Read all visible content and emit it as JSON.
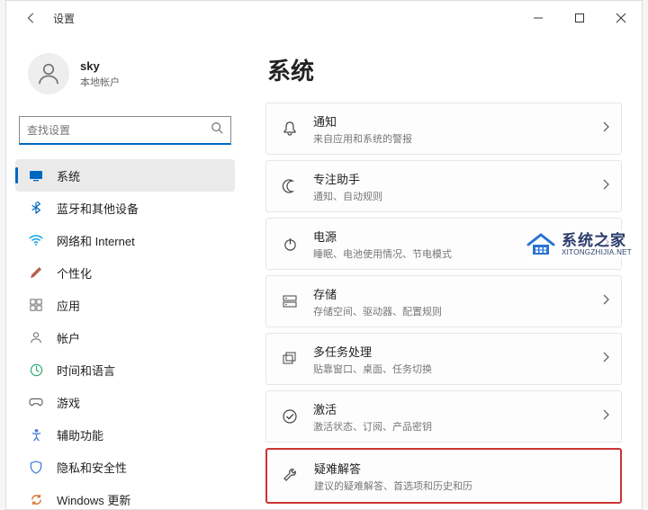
{
  "titlebar": {
    "title": "设置"
  },
  "user": {
    "name": "sky",
    "account_type": "本地帐户"
  },
  "search": {
    "placeholder": "查找设置"
  },
  "sidebar": {
    "items": [
      {
        "label": "系统"
      },
      {
        "label": "蓝牙和其他设备"
      },
      {
        "label": "网络和 Internet"
      },
      {
        "label": "个性化"
      },
      {
        "label": "应用"
      },
      {
        "label": "帐户"
      },
      {
        "label": "时间和语言"
      },
      {
        "label": "游戏"
      },
      {
        "label": "辅助功能"
      },
      {
        "label": "隐私和安全性"
      },
      {
        "label": "Windows 更新"
      }
    ]
  },
  "main": {
    "heading": "系统",
    "rows": [
      {
        "title": "通知",
        "subtitle": "来自应用和系统的警报"
      },
      {
        "title": "专注助手",
        "subtitle": "通知、自动规则"
      },
      {
        "title": "电源",
        "subtitle": "睡眠、电池使用情况、节电模式"
      },
      {
        "title": "存储",
        "subtitle": "存储空间、驱动器、配置规则"
      },
      {
        "title": "多任务处理",
        "subtitle": "贴靠窗口、桌面、任务切换"
      },
      {
        "title": "激活",
        "subtitle": "激活状态、订阅、产品密钥"
      },
      {
        "title": "疑难解答",
        "subtitle": "建议的疑难解答、首选项和历史和历"
      }
    ]
  },
  "watermark": {
    "zh": "系统之家",
    "en": "XITONGZHIJIA.NET"
  }
}
